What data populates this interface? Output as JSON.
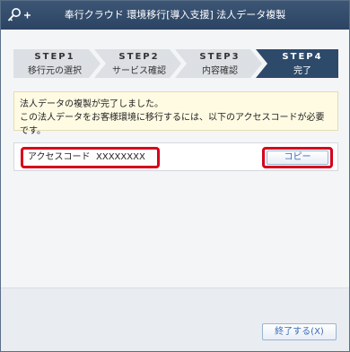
{
  "window": {
    "title": "奉行クラウド 環境移行[導入支援] 法人データ複製"
  },
  "steps": [
    {
      "number": "STEP1",
      "label": "移行元の選択",
      "active": false
    },
    {
      "number": "STEP2",
      "label": "サービス確認",
      "active": false
    },
    {
      "number": "STEP3",
      "label": "内容確認",
      "active": false
    },
    {
      "number": "STEP4",
      "label": "完了",
      "active": true
    }
  ],
  "message": {
    "line1": "法人データの複製が完了しました。",
    "line2": "この法人データをお客様環境に移行するには、以下のアクセスコードが必要です。"
  },
  "access_code": {
    "label": "アクセスコード",
    "value": "XXXXXXXX",
    "copy_label": "コピー"
  },
  "footer": {
    "finish_label": "終了する(X)"
  },
  "colors": {
    "titlebar": "#2c4463",
    "step_inactive": "#dcdfe3",
    "step_active": "#2d4a6b",
    "highlight": "#d7001c",
    "button_text": "#3a6cb8"
  },
  "icons": [
    "key-icon",
    "plus-icon"
  ]
}
